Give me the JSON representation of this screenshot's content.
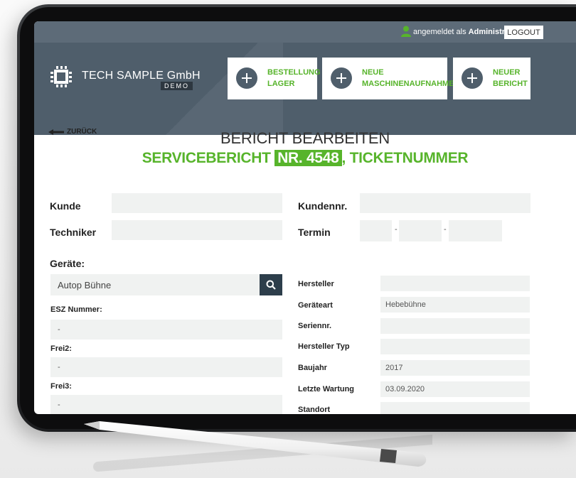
{
  "topbar": {
    "logged_in_prefix": "angemeldet als",
    "user": "Administrator",
    "logout_label": "LOGOUT"
  },
  "brand": {
    "name": "TECH SAMPLE GmbH",
    "tag": "DEMO"
  },
  "actions": [
    {
      "line1": "BESTELLUNG",
      "line2": "LAGER"
    },
    {
      "line1": "NEUE",
      "line2": "MASCHINENAUFNAHME"
    },
    {
      "line1": "NEUER",
      "line2": "BERICHT"
    }
  ],
  "nav": {
    "back_label": "ZURÜCK"
  },
  "page": {
    "title": "BERICHT BEARBEITEN",
    "subtitle_prefix": "SERVICEBERICHT",
    "report_number": "NR. 4548",
    "subtitle_suffix": ", TICKETNUMMER"
  },
  "form": {
    "customer_label": "Kunde",
    "customer_value": "",
    "customer_no_label": "Kundennr.",
    "customer_no_value": "",
    "technician_label": "Techniker",
    "technician_value": "",
    "date_label": "Termin",
    "date_separator": "-",
    "devices_label": "Geräte:",
    "device_search_value": "Autop Bühne"
  },
  "device_left": [
    {
      "label": "ESZ Nummer:",
      "value": "-"
    },
    {
      "label": "Frei2:",
      "value": "-"
    },
    {
      "label": "Frei3:",
      "value": "-"
    }
  ],
  "device_right": [
    {
      "label": "Hersteller",
      "value": ""
    },
    {
      "label": "Geräteart",
      "value": "Hebebühne"
    },
    {
      "label": "Seriennr.",
      "value": ""
    },
    {
      "label": "Hersteller Typ",
      "value": ""
    },
    {
      "label": "Baujahr",
      "value": "2017"
    },
    {
      "label": "Letzte Wartung",
      "value": "03.09.2020"
    },
    {
      "label": "Standort",
      "value": ""
    }
  ],
  "colors": {
    "accent_green": "#57b42b",
    "header_slate": "#4f5e6b",
    "field_bg": "#f0f2f1"
  }
}
